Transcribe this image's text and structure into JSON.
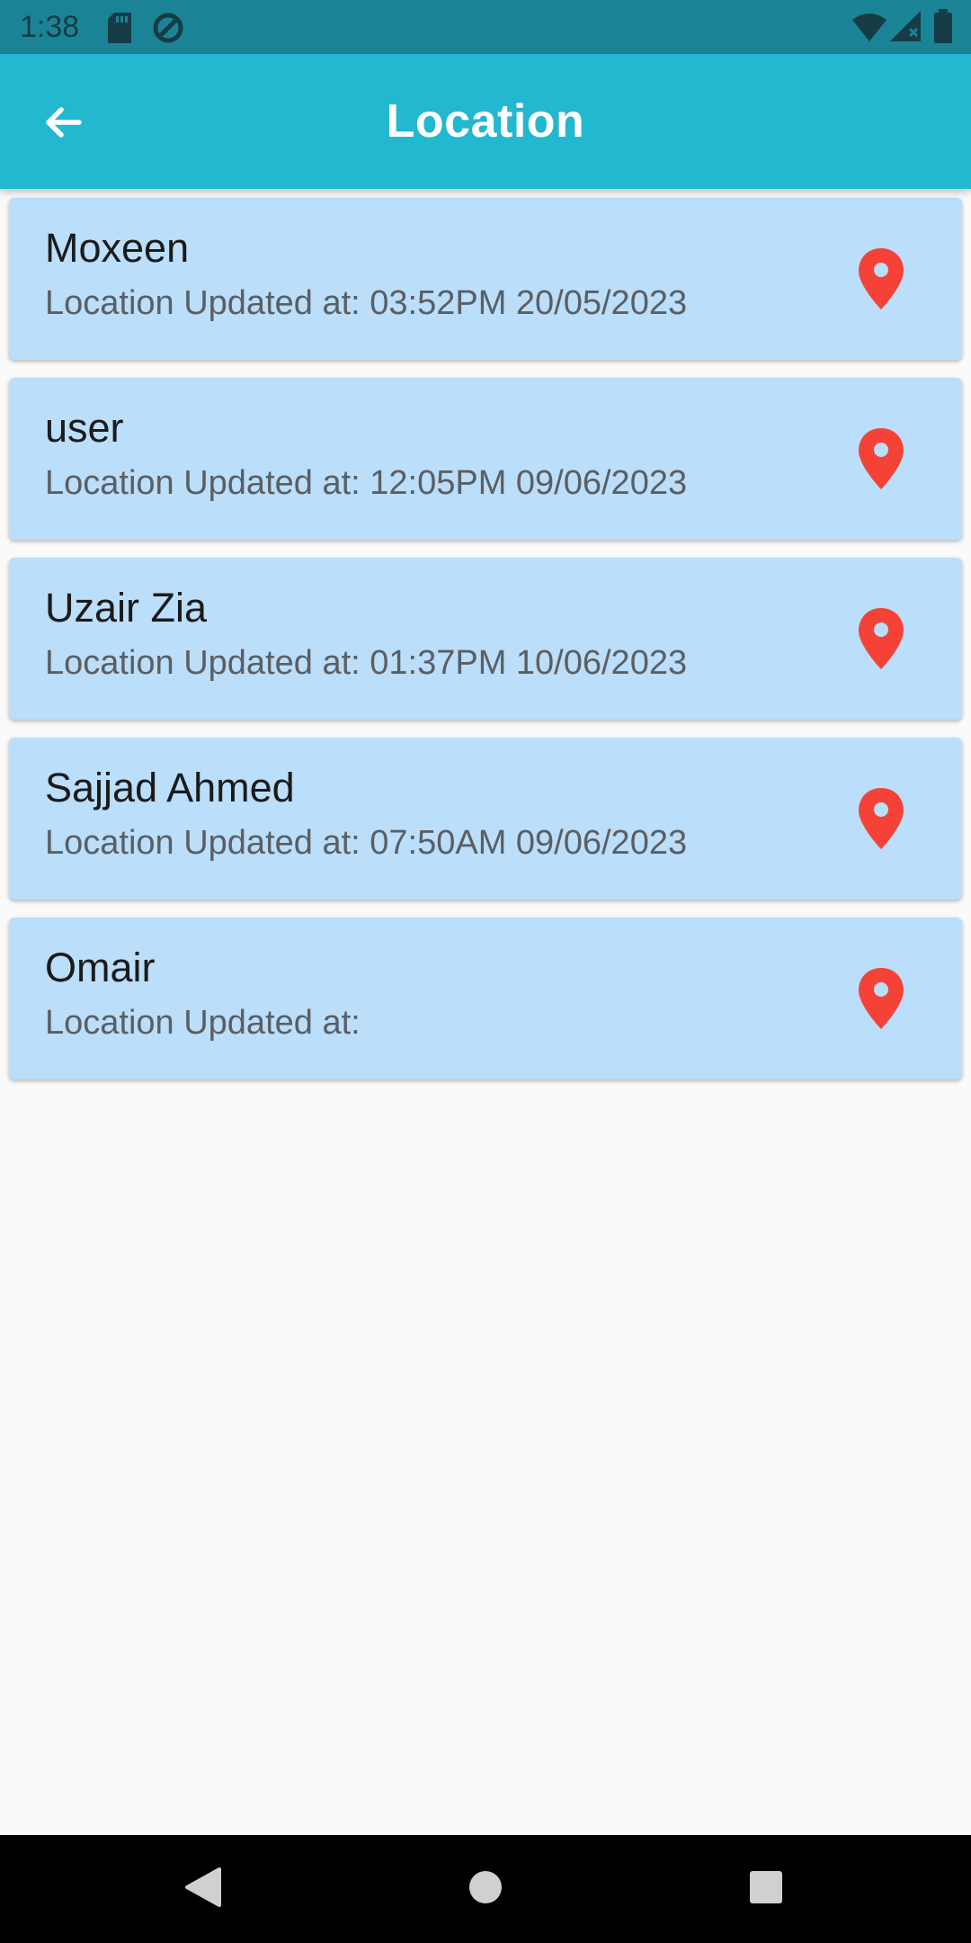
{
  "status_bar": {
    "time": "1:38",
    "icons": [
      "sd-card-icon",
      "data-saver-icon",
      "wifi-icon",
      "signal-icon",
      "battery-icon"
    ]
  },
  "app_bar": {
    "title": "Location",
    "back_icon": "arrow-back-icon",
    "background": "#22b8cf"
  },
  "locations": [
    {
      "name": "Moxeen",
      "updated": "Location Updated at: 03:52PM 20/05/2023"
    },
    {
      "name": "user",
      "updated": "Location Updated at: 12:05PM 09/06/2023"
    },
    {
      "name": "Uzair Zia",
      "updated": "Location Updated at: 01:37PM 10/06/2023"
    },
    {
      "name": "Sajjad Ahmed",
      "updated": "Location Updated at: 07:50AM 09/06/2023"
    },
    {
      "name": "Omair",
      "updated": "Location Updated at:"
    }
  ],
  "colors": {
    "card_background": "#bbdefa",
    "pin": "#f44336",
    "status_bar": "#1a8496"
  },
  "nav_bar": {
    "icons": [
      "back-triangle-icon",
      "home-circle-icon",
      "recents-square-icon"
    ]
  }
}
